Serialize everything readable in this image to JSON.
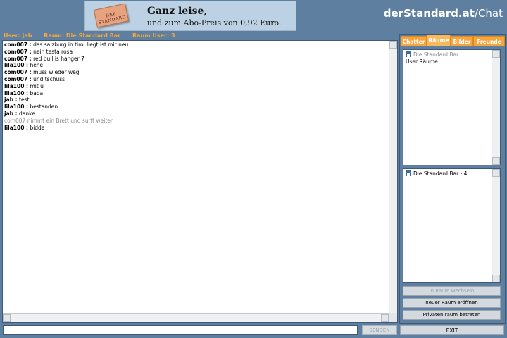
{
  "banner": {
    "paper_brand": "DER STANDARD",
    "headline": "Ganz leise,",
    "subline": "und zum Abo-Preis von 0,92 Euro."
  },
  "logo": {
    "brand": "derStandard.at",
    "separator": "/",
    "app": "Chat"
  },
  "status": {
    "user": "User: jab",
    "room": "Raum: Die Standard Bar",
    "room_users": "Raum User: 3"
  },
  "colors": {
    "background": "#5e7f9f",
    "accent": "#f6a43c"
  },
  "chat": {
    "messages": [
      {
        "user": "com007 :",
        "text": "das salzburg in tirol liegt ist mir neu"
      },
      {
        "user": "com007 :",
        "text": "nein testa rosa"
      },
      {
        "user": "com007 :",
        "text": "red bull is hanger 7"
      },
      {
        "user": "lila100 :",
        "text": "hehe"
      },
      {
        "user": "com007 :",
        "text": "muss wieder weg"
      },
      {
        "user": "com007 :",
        "text": "und tschüss"
      },
      {
        "user": "lila100 :",
        "text": "mit ü"
      },
      {
        "user": "lila100 :",
        "text": "baba"
      },
      {
        "user": "jab :",
        "text": "test"
      },
      {
        "user": "lila100 :",
        "text": "bestanden"
      },
      {
        "user": "jab :",
        "text": "danke"
      },
      {
        "system": "com007 nimmt ein Brett und surft weiter"
      },
      {
        "user": "lila100 :",
        "text": "bidde"
      }
    ]
  },
  "input": {
    "value": "",
    "send_label": "SENDEN"
  },
  "tabs": [
    {
      "label": "Chatter"
    },
    {
      "label": "Räume"
    },
    {
      "label": "Bilder"
    },
    {
      "label": "Freunde"
    }
  ],
  "rooms": {
    "items": [
      {
        "label": "Die Standard Bar",
        "icon": "house-icon"
      },
      {
        "label": "User Räume"
      }
    ]
  },
  "users": {
    "items": [
      {
        "label": "Die Standard Bar - 4",
        "icon": "house-icon"
      }
    ]
  },
  "buttons": {
    "switch_room": "in Raum wechseln",
    "new_room": "neuer Raum eröffnen",
    "private_room": "Privaten raum betreten",
    "exit": "EXIT"
  }
}
